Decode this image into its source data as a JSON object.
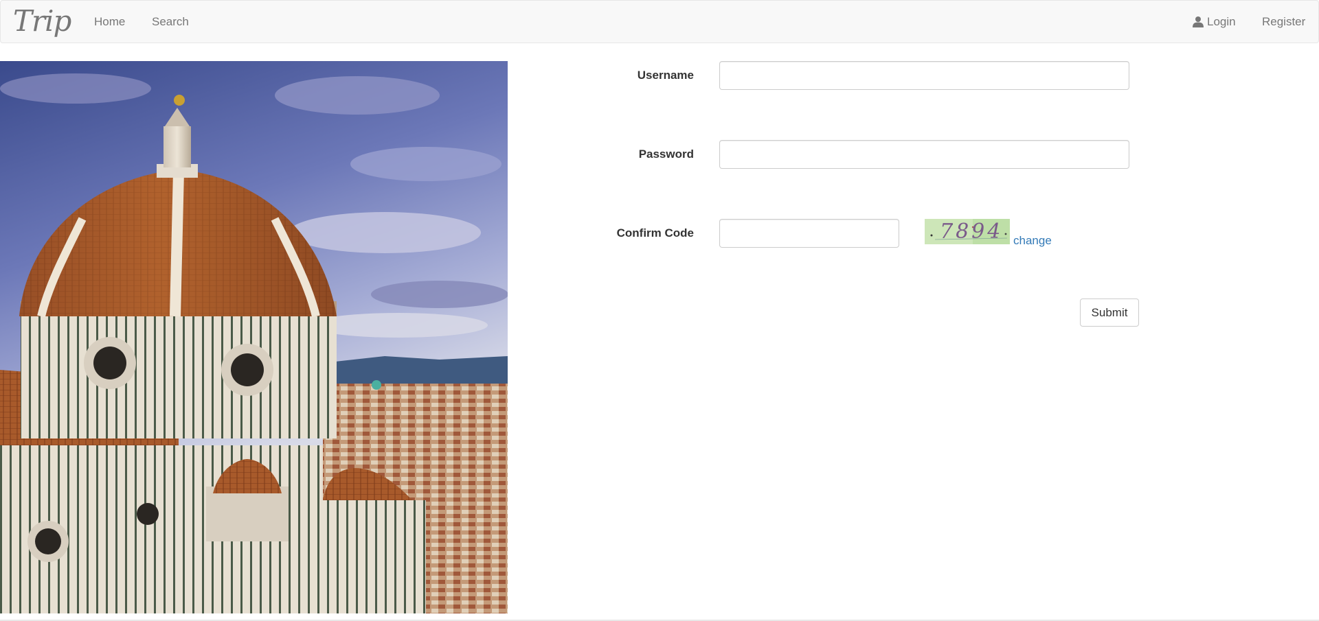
{
  "navbar": {
    "brand": "Trip",
    "links": {
      "home": "Home",
      "search": "Search",
      "login": "Login",
      "register": "Register"
    },
    "icons": {
      "login": "user-icon"
    }
  },
  "form": {
    "username_label": "Username",
    "password_label": "Password",
    "confirm_label": "Confirm Code",
    "username_value": "",
    "password_value": "",
    "confirm_value": "",
    "captcha_text": "7894",
    "change_label": "change",
    "submit_label": "Submit"
  },
  "colors": {
    "navbar_bg": "#f8f8f8",
    "link": "#337ab7",
    "nav_text": "#777777"
  }
}
